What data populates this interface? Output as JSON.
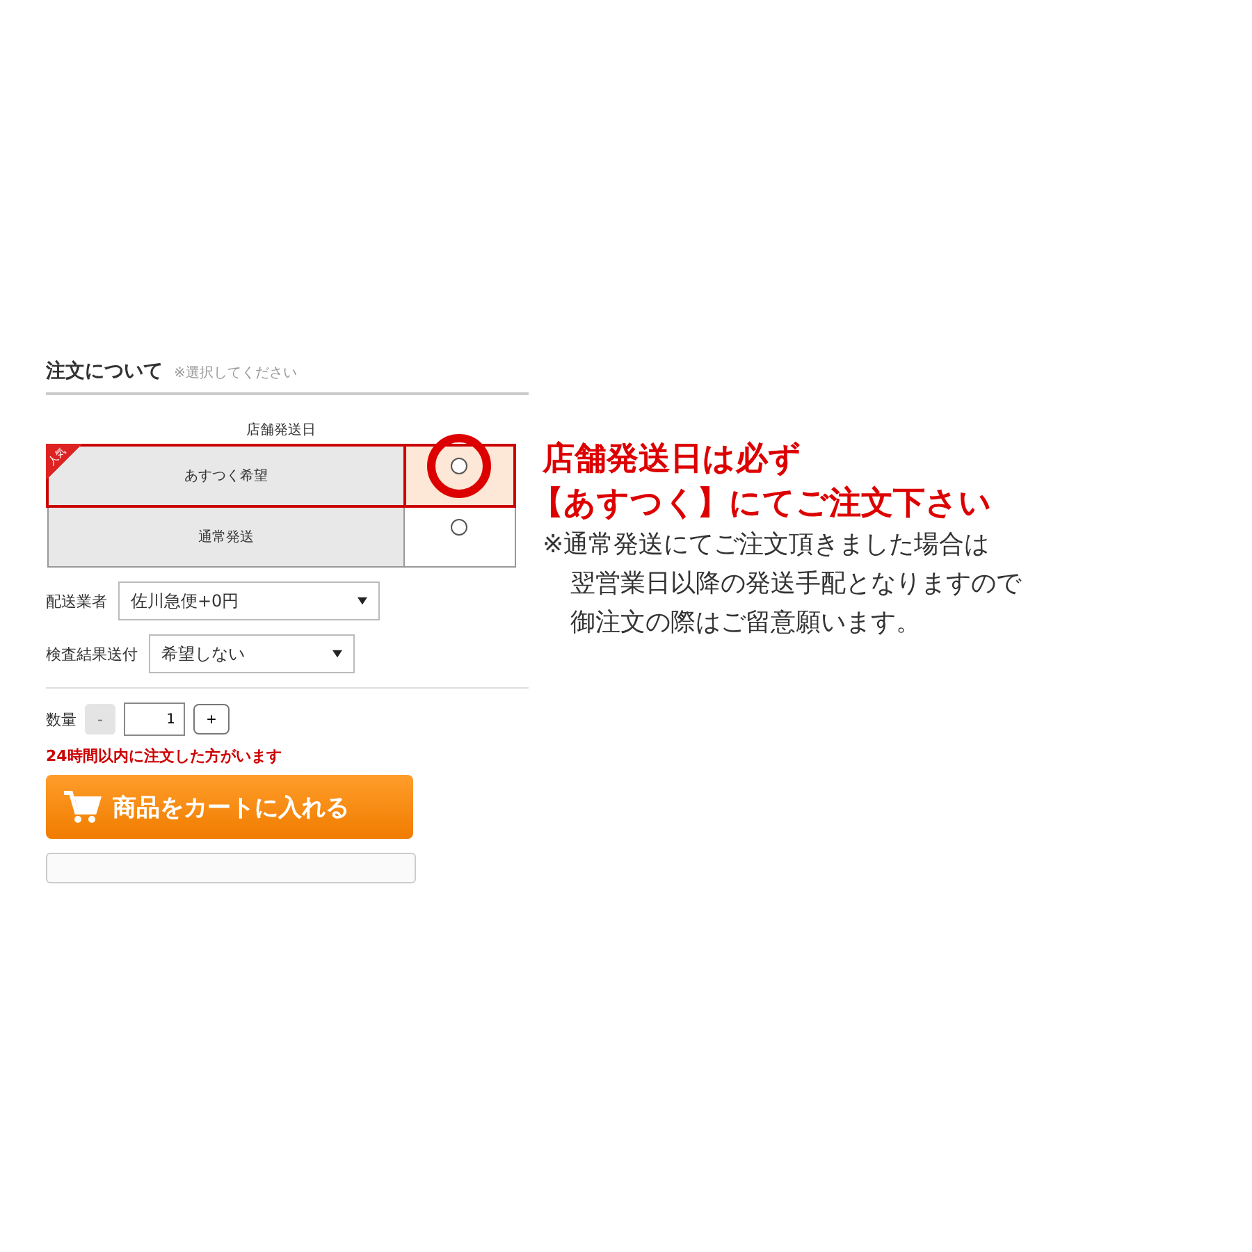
{
  "section": {
    "title": "注文について",
    "hint": "※選択してください"
  },
  "shipping_date": {
    "heading": "店舗発送日",
    "options": [
      {
        "label": "あすつく希望",
        "badge": "人気",
        "highlighted": true,
        "selected": false
      },
      {
        "label": "通常発送",
        "highlighted": false,
        "selected": false
      }
    ]
  },
  "fields": [
    {
      "label": "配送業者",
      "value": "佐川急便+0円"
    },
    {
      "label": "検査結果送付",
      "value": "希望しない"
    }
  ],
  "quantity": {
    "label": "数量",
    "minus": "-",
    "value": "1",
    "plus": "+"
  },
  "notice": "24時間以内に注文した方がいます",
  "cart_button": "商品をカートに入れる",
  "annotation": {
    "headline": [
      "店舗発送日は必ず",
      "【あすつく】にてご注文下さい"
    ],
    "note": [
      "※通常発送にてご注文頂きました場合は",
      "翌営業日以降の発送手配となりますので",
      "御注文の際はご留意願います。"
    ]
  }
}
